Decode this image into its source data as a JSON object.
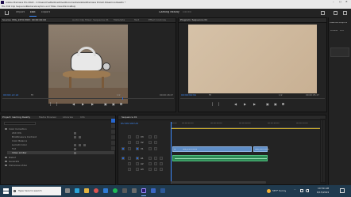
{
  "window": {
    "title": "Adobe Premiere Pro 2022 - C:\\Users\\Yvette\\OneDrive\\Documents\\Adobe\\Premiere Pro\\22.0\\Gaming Reality *",
    "controls": [
      "–",
      "▢",
      "✕"
    ]
  },
  "menu": [
    "File",
    "Edit",
    "Clip",
    "Sequence",
    "Markers",
    "Graphics and Titles",
    "View",
    "Window",
    "Help"
  ],
  "workspace": {
    "tabs": [
      {
        "label": "Import"
      },
      {
        "label": "Edit"
      },
      {
        "label": "Export"
      }
    ],
    "center_title": "Gaming Reality",
    "center_extra": "Edited"
  },
  "source": {
    "tabs": [
      "Source: IMG_2470.MOV: 00:00:00:00",
      "Audio Clip Mixer: Sequence 01",
      "Metadata",
      "Text",
      "Effect Controls"
    ],
    "timecode": "00:00:13:14",
    "fit": "Fit",
    "ratio": "1/2",
    "duration": "00:00:18:27"
  },
  "program": {
    "tabs": [
      "Program: Sequence 01"
    ],
    "timecode": "00:00:00:00",
    "fit": "Fit",
    "ratio": "1/2",
    "duration": "00:00:05:27"
  },
  "right_panel": {
    "title": "Essential Graphics",
    "items": [
      "Browse",
      "Edit"
    ]
  },
  "project": {
    "tabs": [
      "Project: Gaming Reality",
      "Media Browser",
      "Libraries",
      "Info"
    ],
    "items": [
      {
        "label": "Color Correction"
      },
      {
        "label": "ASC CDL"
      },
      {
        "label": "Brightness & Contrast"
      },
      {
        "label": "Color Balance"
      },
      {
        "label": "Lumetri Color"
      },
      {
        "label": "Tint"
      },
      {
        "label": "Video Limiter"
      },
      {
        "label": "Distort"
      },
      {
        "label": "Generate"
      },
      {
        "label": "Immersive Video"
      }
    ]
  },
  "timeline": {
    "tab": "Sequence 01",
    "timecode": "00:00:00:00",
    "ruler": [
      ":00:00",
      "00:00:02:00",
      "00:00:04:00",
      "00:00:06:00",
      "00:00:08:00",
      "00:00:10:00"
    ],
    "tracks": [
      "V3",
      "V2",
      "V1",
      "A1",
      "A2",
      "A3"
    ],
    "clip_labels": [
      "fx",
      "IMG_2470.MOV",
      "IMG_2470.MOV"
    ]
  },
  "taskbar": {
    "search_placeholder": "Type here to search",
    "weather": "58°F Sunny",
    "time": "10:59 AM",
    "date": "6/15/2022"
  }
}
